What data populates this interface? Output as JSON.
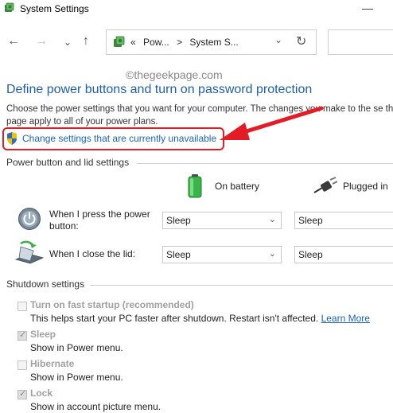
{
  "window": {
    "title": "System Settings"
  },
  "nav": {
    "breadcrumb": {
      "sep": "«",
      "item1": "Pow...",
      "chevron": ">",
      "item2": "System S..."
    }
  },
  "watermark": "©thegeekpage.com",
  "page": {
    "heading": "Define power buttons and turn on password protection",
    "description": "Choose the power settings that you want for your computer. The changes you make to the se this page apply to all of your power plans.",
    "change_link": "Change settings that are currently unavailable"
  },
  "power_section": {
    "label": "Power button and lid settings",
    "col_battery": "On battery",
    "col_plugged": "Plugged in",
    "rows": [
      {
        "label": "When I press the power button:",
        "battery": "Sleep",
        "plugged": "Sleep"
      },
      {
        "label": "When I close the lid:",
        "battery": "Sleep",
        "plugged": "Sleep"
      }
    ]
  },
  "shutdown_section": {
    "label": "Shutdown settings",
    "fast_startup": {
      "label": "Turn on fast startup (recommended)",
      "desc": "This helps start your PC faster after shutdown. Restart isn't affected.",
      "learn_more": "Learn More",
      "checked": false
    },
    "sleep": {
      "label": "Sleep",
      "desc": "Show in Power menu.",
      "checked": true
    },
    "hibernate": {
      "label": "Hibernate",
      "desc": "Show in Power menu.",
      "checked": false
    },
    "lock": {
      "label": "Lock",
      "desc": "Show in account picture menu.",
      "checked": true
    }
  },
  "colors": {
    "heading": "#1f5fa6",
    "link": "#1a63b8",
    "annotation": "#e21d25"
  }
}
